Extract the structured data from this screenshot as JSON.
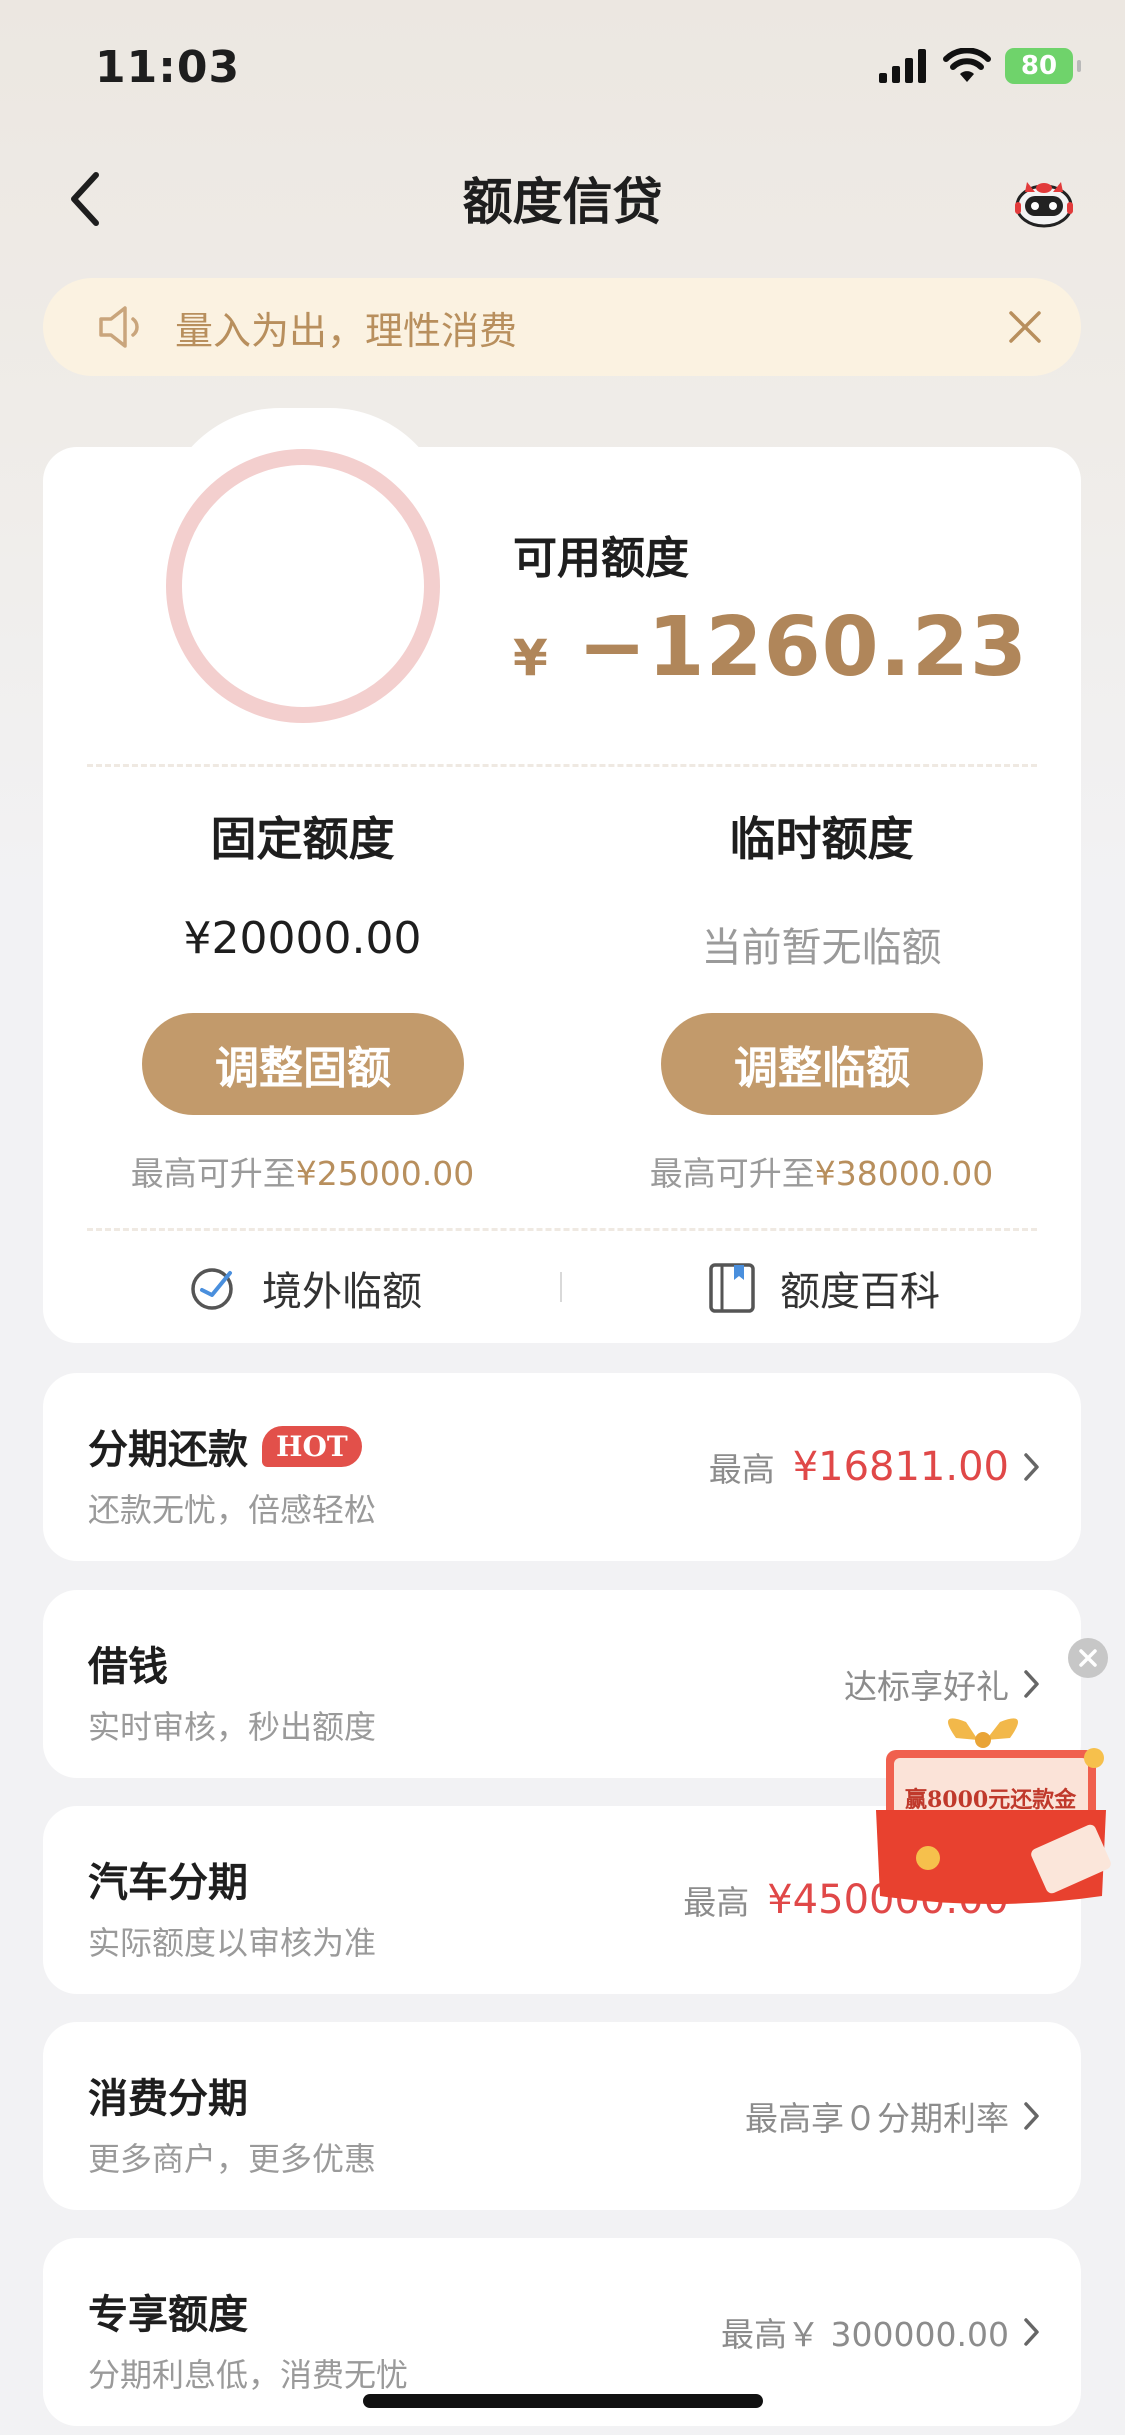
{
  "status_bar": {
    "time": "11:03",
    "battery": "80"
  },
  "nav": {
    "title": "额度信贷"
  },
  "notice": {
    "text": "量入为出，理性消费"
  },
  "credit": {
    "available_label": "可用额度",
    "currency": "¥",
    "available_amount": "−1260.23",
    "fixed": {
      "title": "固定额度",
      "value": "¥20000.00",
      "button": "调整固额",
      "hint_prefix": "最高可升至",
      "hint_amount": "¥25000.00"
    },
    "temporary": {
      "title": "临时额度",
      "value": "当前暂无临额",
      "button": "调整临额",
      "hint_prefix": "最高可升至",
      "hint_amount": "¥38000.00"
    },
    "links": {
      "overseas": "境外临额",
      "encyclopedia": "额度百科"
    }
  },
  "services": [
    {
      "title": "分期还款",
      "badge": "HOT",
      "subtitle": "还款无忧，倍感轻松",
      "right_prefix": "最高",
      "right_value": "¥16811.00"
    },
    {
      "title": "借钱",
      "subtitle": "实时审核，秒出额度",
      "right_text": "达标享好礼"
    },
    {
      "title": "汽车分期",
      "subtitle": "实际额度以审核为准",
      "right_prefix": "最高",
      "right_value": "¥450000.00"
    },
    {
      "title": "消费分期",
      "subtitle": "更多商户，更多优惠",
      "right_text": "最高享０分期利率"
    },
    {
      "title": "专享额度",
      "subtitle": "分期利息低，消费无忧",
      "right_text": "最高￥ 300000.00"
    }
  ],
  "promo": {
    "text": "赢8000元还款金"
  },
  "colors": {
    "gold": "#b88f5d",
    "button": "#c29a6b",
    "red": "#e04848",
    "ring": "#f3cfce"
  }
}
